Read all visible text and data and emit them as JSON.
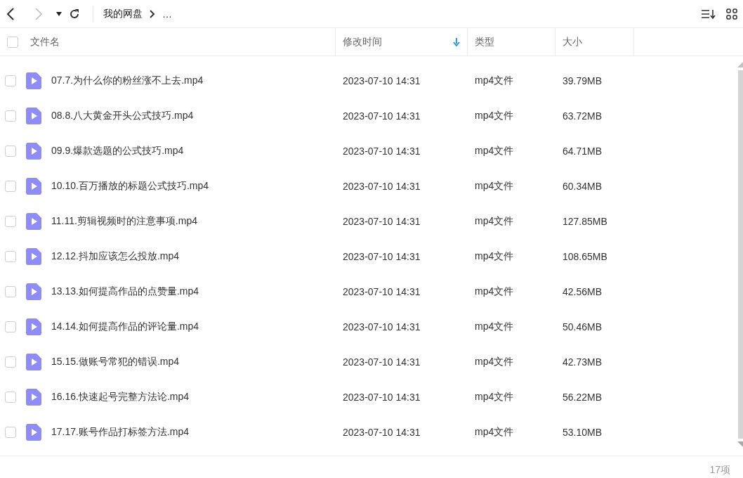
{
  "toolbar": {
    "breadcrumb": [
      {
        "label": "我的网盘"
      },
      {
        "label": "…"
      }
    ]
  },
  "header": {
    "checked": false,
    "columns": [
      {
        "label": "文件名",
        "sorted": false
      },
      {
        "label": "修改时间",
        "sorted": true
      },
      {
        "label": "类型",
        "sorted": false
      },
      {
        "label": "大小",
        "sorted": false
      }
    ]
  },
  "rows": [
    {
      "name": "07.7.为什么你的粉丝涨不上去.mp4",
      "modified": "2023-07-10 14:31",
      "type": "mp4文件",
      "size": "39.79MB",
      "checked": false
    },
    {
      "name": "08.8.八大黄金开头公式技巧.mp4",
      "modified": "2023-07-10 14:31",
      "type": "mp4文件",
      "size": "63.72MB",
      "checked": false
    },
    {
      "name": "09.9.爆款选题的公式技巧.mp4",
      "modified": "2023-07-10 14:31",
      "type": "mp4文件",
      "size": "64.71MB",
      "checked": false
    },
    {
      "name": "10.10.百万播放的标题公式技巧.mp4",
      "modified": "2023-07-10 14:31",
      "type": "mp4文件",
      "size": "60.34MB",
      "checked": false
    },
    {
      "name": "11.11.剪辑视频时的注意事项.mp4",
      "modified": "2023-07-10 14:31",
      "type": "mp4文件",
      "size": "127.85MB",
      "checked": false
    },
    {
      "name": "12.12.抖加应该怎么投放.mp4",
      "modified": "2023-07-10 14:31",
      "type": "mp4文件",
      "size": "108.65MB",
      "checked": false
    },
    {
      "name": "13.13.如何提高作品的点赞量.mp4",
      "modified": "2023-07-10 14:31",
      "type": "mp4文件",
      "size": "42.56MB",
      "checked": false
    },
    {
      "name": "14.14.如何提高作品的评论量.mp4",
      "modified": "2023-07-10 14:31",
      "type": "mp4文件",
      "size": "50.46MB",
      "checked": false
    },
    {
      "name": "15.15.做账号常犯的错误.mp4",
      "modified": "2023-07-10 14:31",
      "type": "mp4文件",
      "size": "42.73MB",
      "checked": false
    },
    {
      "name": "16.16.快速起号完整方法论.mp4",
      "modified": "2023-07-10 14:31",
      "type": "mp4文件",
      "size": "56.22MB",
      "checked": false
    },
    {
      "name": "17.17.账号作品打标签方法.mp4",
      "modified": "2023-07-10 14:31",
      "type": "mp4文件",
      "size": "53.10MB",
      "checked": false
    }
  ],
  "footer": {
    "count": "17项"
  }
}
